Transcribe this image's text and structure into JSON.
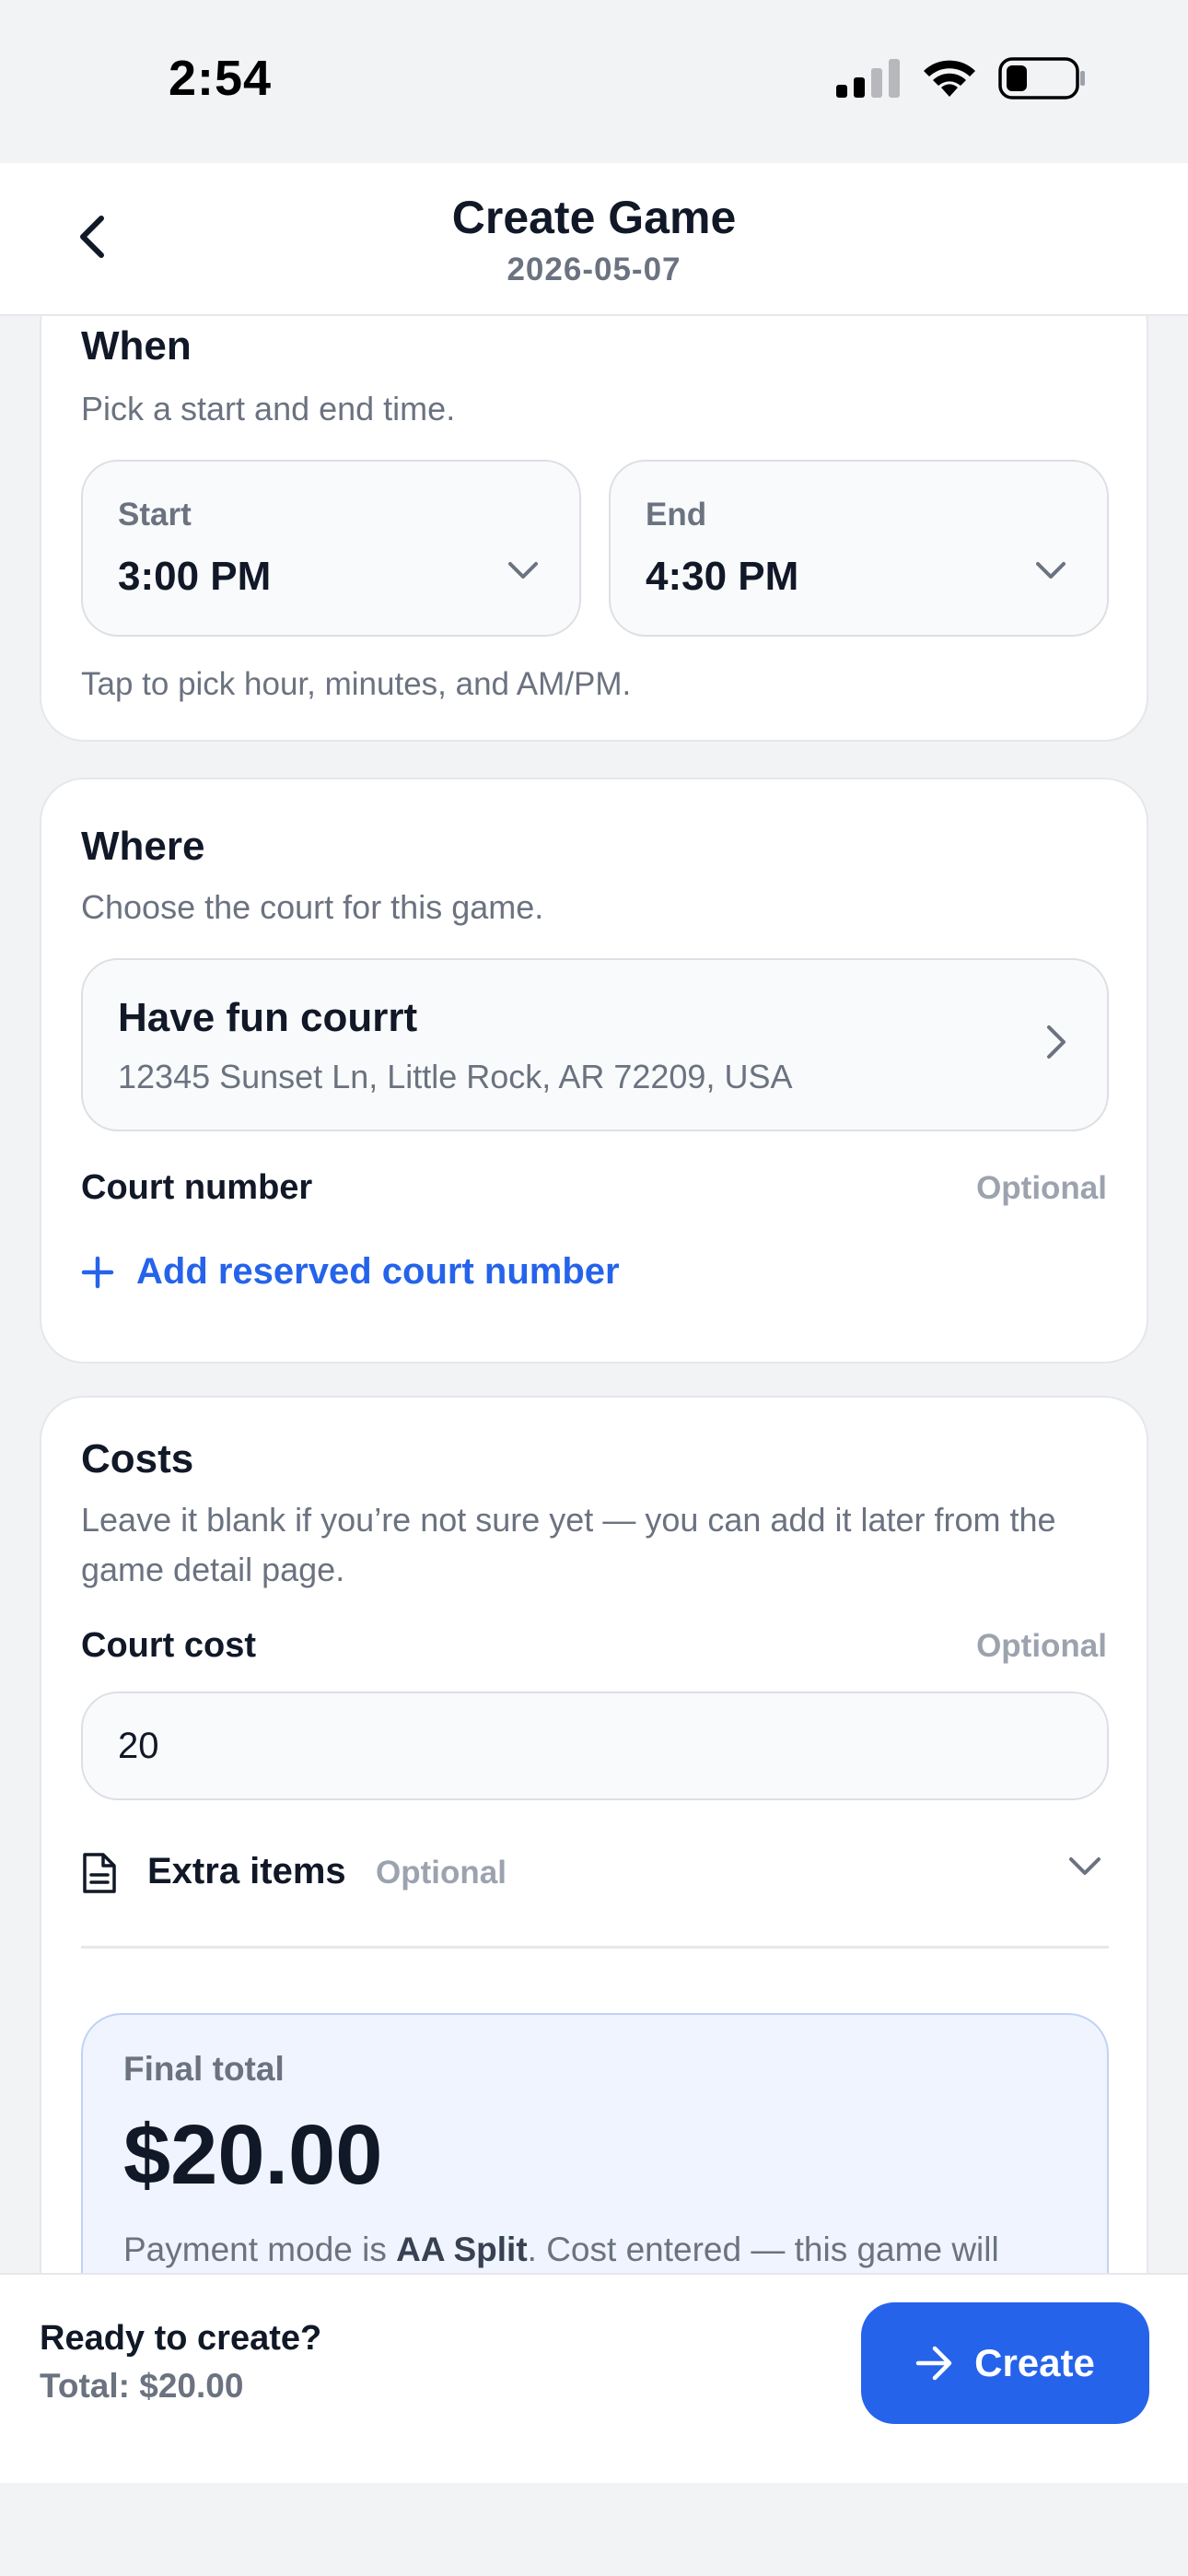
{
  "status_bar": {
    "time": "2:54"
  },
  "nav": {
    "title": "Create Game",
    "date": "2026-05-07"
  },
  "when": {
    "title": "When",
    "description": "Pick a start and end time.",
    "start_label": "Start",
    "start_value": "3:00 PM",
    "end_label": "End",
    "end_value": "4:30 PM",
    "hint": "Tap to pick hour, minutes, and AM/PM."
  },
  "where": {
    "title": "Where",
    "description": "Choose the court for this game.",
    "court_name": "Have fun courrt",
    "court_address": "12345 Sunset Ln, Little Rock, AR 72209, USA",
    "court_number_label": "Court number",
    "court_number_optional": "Optional",
    "add_court_number": "Add reserved court number"
  },
  "costs": {
    "title": "Costs",
    "description": "Leave it blank if you’re not sure yet — you can add it later from the game detail page.",
    "court_cost_label": "Court cost",
    "court_cost_optional": "Optional",
    "court_cost_value": "20",
    "extra_items_label": "Extra items",
    "extra_items_optional": "Optional",
    "final_total_label": "Final total",
    "final_total_value": "$20.00",
    "note_prefix": "Payment mode is ",
    "note_mode": "AA Split",
    "note_suffix": ". Cost entered — this game will"
  },
  "footer": {
    "ready_label": "Ready to create?",
    "total_text": "Total: $20.00",
    "create_label": "Create"
  },
  "colors": {
    "accent": "#2563eb",
    "total_bg": "#eff4fe"
  }
}
